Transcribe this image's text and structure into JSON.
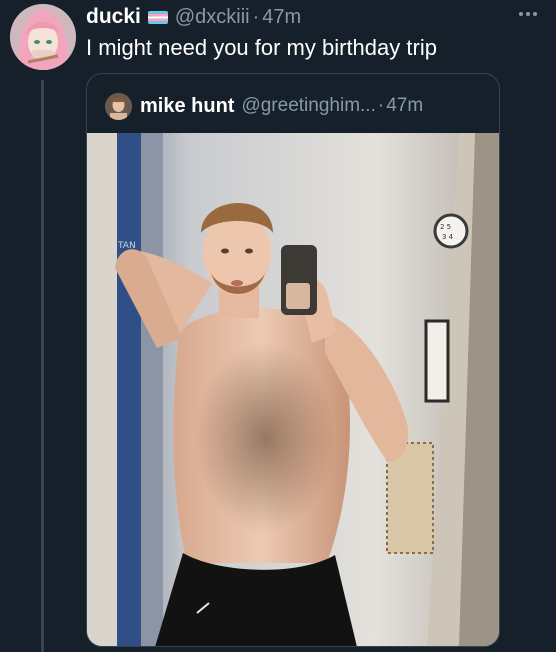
{
  "tweet": {
    "display_name": "ducki",
    "handle": "@dxckiii",
    "separator": "·",
    "time": "47m",
    "text": "I might need you for my birthday trip",
    "more_icon": "more-horizontal-icon",
    "flag_icon": "transgender-flag-icon",
    "flag_colors": [
      "#5bcefa",
      "#f5a9b8",
      "#ffffff",
      "#f5a9b8",
      "#5bcefa"
    ]
  },
  "quote": {
    "display_name": "mike hunt",
    "handle": "@greetinghim...",
    "separator": "·",
    "time": "47m"
  },
  "colors": {
    "background": "#15202b",
    "secondary_text": "#8899a6",
    "border": "#38444d"
  }
}
